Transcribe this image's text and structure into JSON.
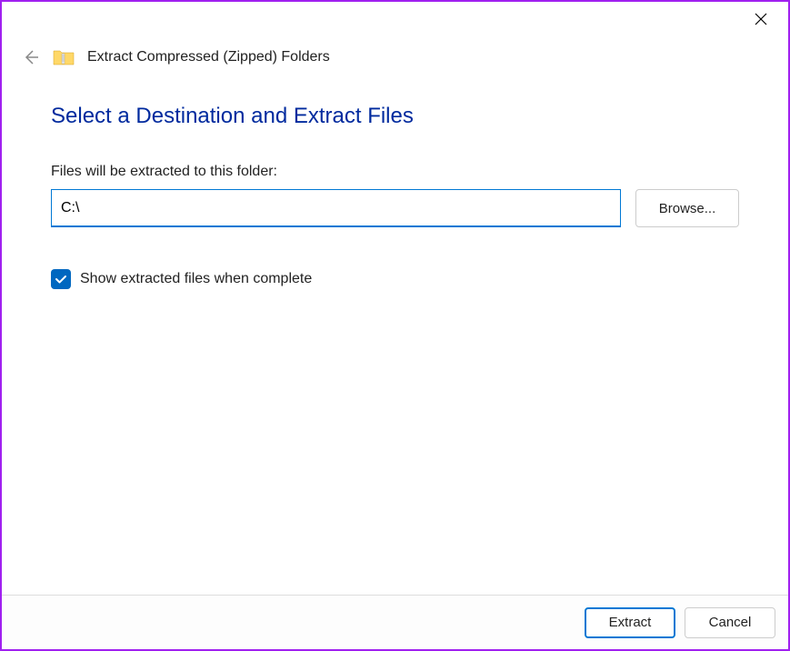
{
  "window": {
    "title": "Extract Compressed (Zipped) Folders"
  },
  "content": {
    "heading": "Select a Destination and Extract Files",
    "path_label": "Files will be extracted to this folder:",
    "path_value": "C:\\",
    "browse_label": "Browse...",
    "checkbox_label": "Show extracted files when complete",
    "checkbox_checked": true
  },
  "footer": {
    "extract_label": "Extract",
    "cancel_label": "Cancel"
  }
}
